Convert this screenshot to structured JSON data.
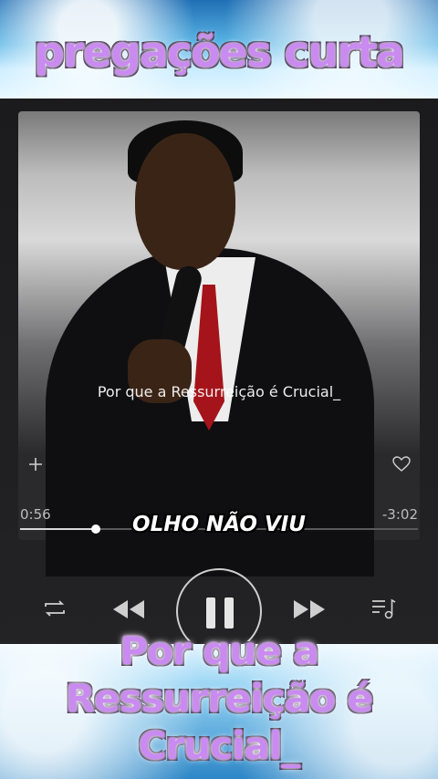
{
  "header": {
    "title": "pregações curta"
  },
  "player": {
    "overlay_text": "Por que a Ressurreição é Crucial_",
    "elapsed": "0:56",
    "remaining": "-3:02",
    "track_title": "OLHO NÃO VIU",
    "progress_fraction": 0.19,
    "icons": {
      "add": "plus-icon",
      "favorite": "heart-icon",
      "repeat": "repeat-icon",
      "previous": "rewind-icon",
      "pause": "pause-icon",
      "next": "fast-forward-icon",
      "playlist": "playlist-icon"
    }
  },
  "caption": {
    "line1": "Por que a",
    "line2": "Ressurreição é",
    "line3": "Crucial_"
  },
  "colors": {
    "title_purple": "#c98bf0",
    "frame_blue": "#5bb6e6"
  }
}
